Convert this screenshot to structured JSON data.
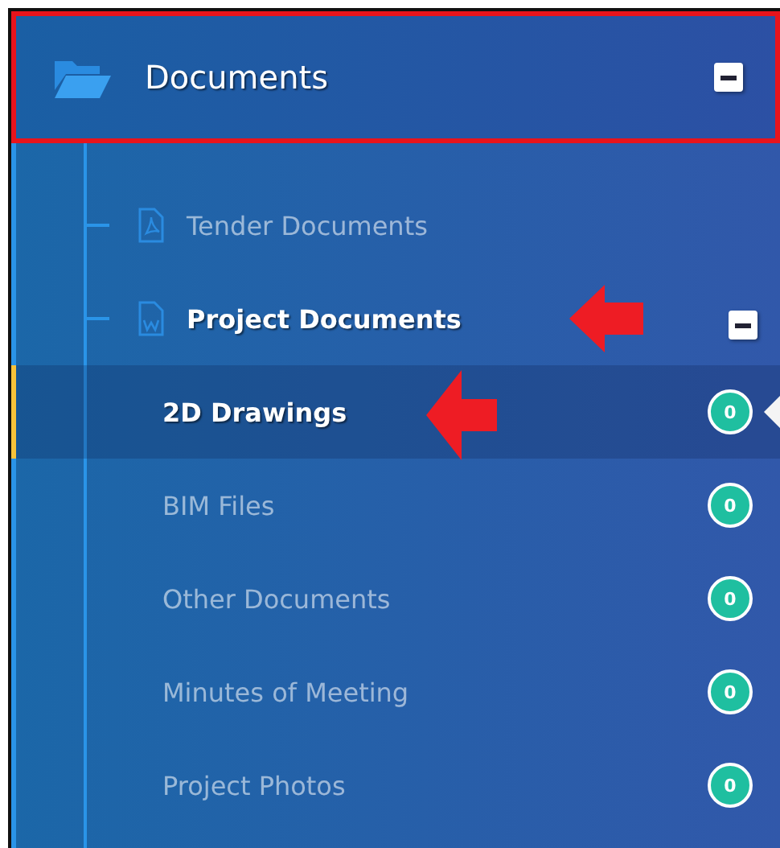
{
  "header": {
    "title": "Documents",
    "expanded": true,
    "annotated": true
  },
  "folders": [
    {
      "label": "Tender Documents",
      "kind": "pdf",
      "active": false,
      "annotated": false
    },
    {
      "label": "Project Documents",
      "kind": "word",
      "active": true,
      "expanded": true,
      "annotated": true,
      "children": [
        {
          "label": "2D Drawings",
          "count": "0",
          "selected": true,
          "annotated": true
        },
        {
          "label": "BIM Files",
          "count": "0",
          "selected": false,
          "annotated": false
        },
        {
          "label": "Other Documents",
          "count": "0",
          "selected": false,
          "annotated": false
        },
        {
          "label": "Minutes of Meeting",
          "count": "0",
          "selected": false,
          "annotated": false
        },
        {
          "label": "Project Photos",
          "count": "0",
          "selected": false,
          "annotated": false
        }
      ]
    }
  ]
}
